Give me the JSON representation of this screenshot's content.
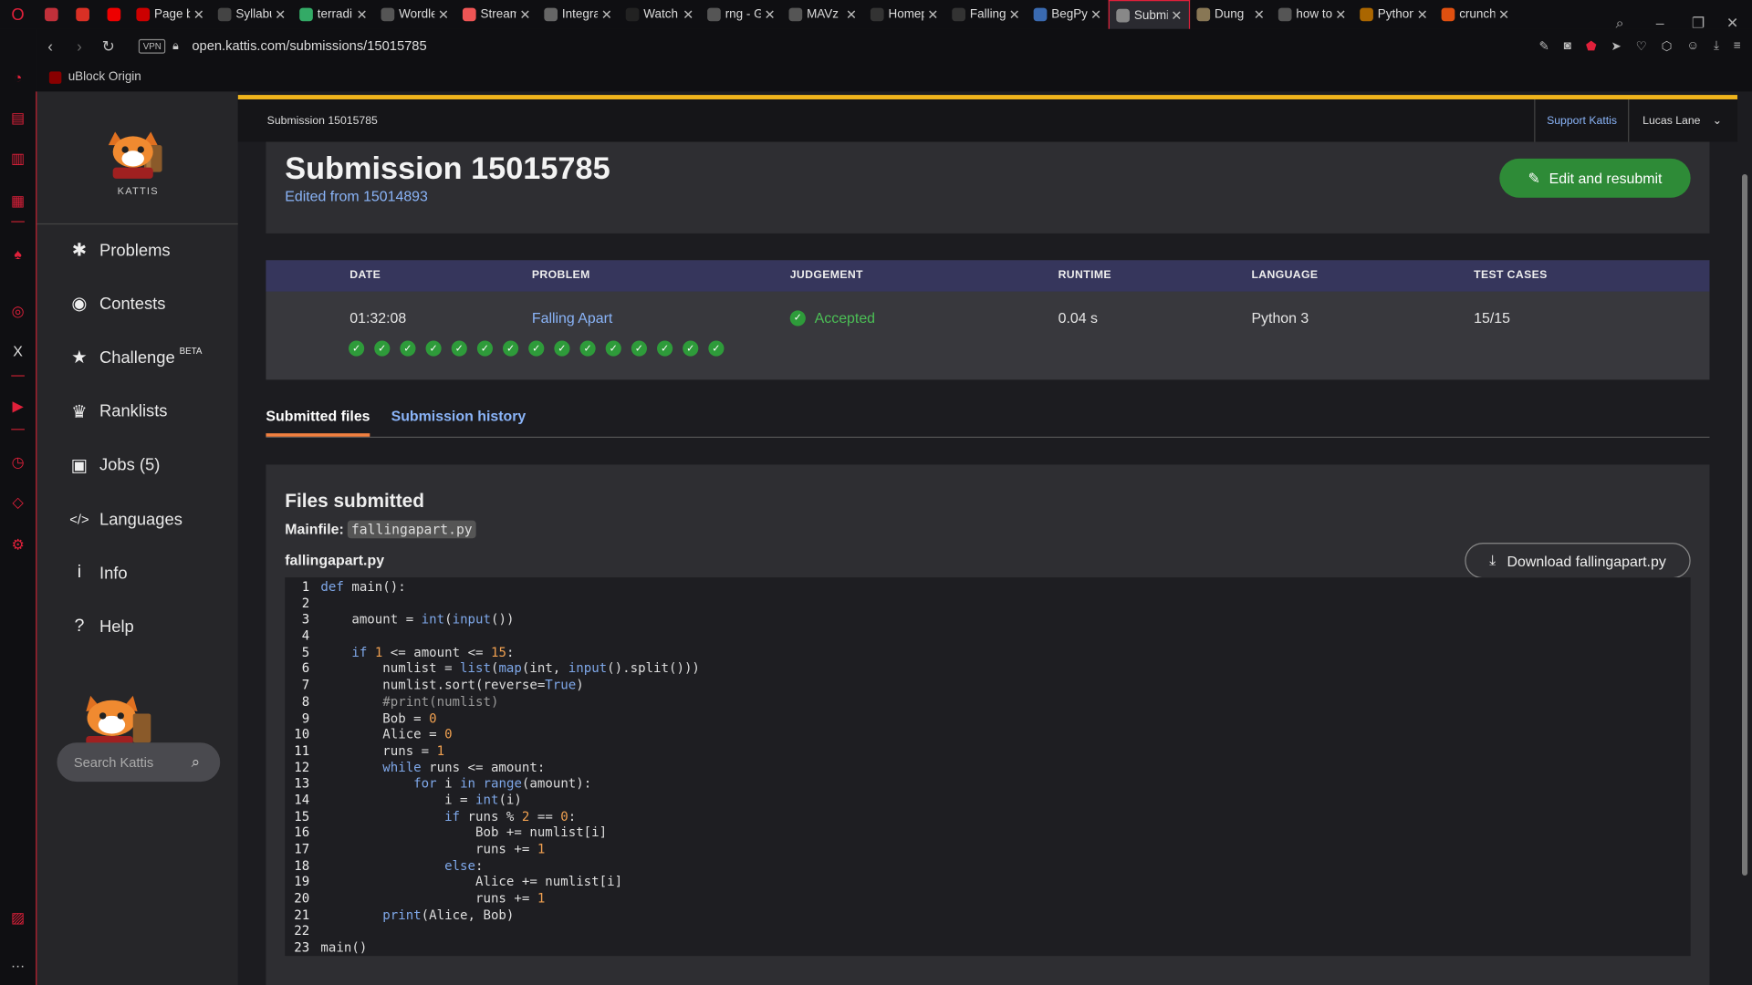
{
  "browser": {
    "tabs": [
      {
        "title": "",
        "color": "#c0303a",
        "icon": "gamepad-icon"
      },
      {
        "title": "",
        "color": "#d93025",
        "icon": "gmail-icon"
      },
      {
        "title": "",
        "color": "#e00",
        "icon": "youtube-icon"
      },
      {
        "title": "Page b",
        "color": "#c00",
        "icon": "page-icon"
      },
      {
        "title": "Syllabu",
        "color": "#444",
        "icon": "syllabus-icon"
      },
      {
        "title": "terradi",
        "color": "#3a6",
        "icon": "terra-icon"
      },
      {
        "title": "Wordle",
        "color": "#555",
        "icon": "wordle-icon"
      },
      {
        "title": "Stream",
        "color": "#e55",
        "icon": "stream-icon"
      },
      {
        "title": "Integra",
        "color": "#666",
        "icon": "integral-icon"
      },
      {
        "title": "Watch",
        "color": "#222",
        "icon": "amazon-icon"
      },
      {
        "title": "rng - G",
        "color": "#555",
        "icon": "google-icon"
      },
      {
        "title": "MAVz",
        "color": "#555",
        "icon": "mav-icon"
      },
      {
        "title": "Homep",
        "color": "#333",
        "icon": "dil-icon"
      },
      {
        "title": "Falling",
        "color": "#333",
        "icon": "github-icon"
      },
      {
        "title": "BegPy",
        "color": "#3a6ab0",
        "icon": "begpy-icon"
      },
      {
        "title": "Submi",
        "color": "#888",
        "icon": "kattis-icon",
        "active": true
      },
      {
        "title": "Dung",
        "color": "#875",
        "icon": "dung-icon"
      },
      {
        "title": "how to",
        "color": "#555",
        "icon": "google-icon"
      },
      {
        "title": "Python",
        "color": "#a60",
        "icon": "python-icon"
      },
      {
        "title": "crunch",
        "color": "#e05010",
        "icon": "crunchyroll-icon"
      }
    ],
    "url": "open.kattis.com/submissions/15015785",
    "vpn": "VPN",
    "bookmark": "uBlock Origin"
  },
  "kattis": {
    "brand": "KATTIS",
    "nav": [
      {
        "label": "Problems",
        "icon": "puzzle-icon",
        "glyph": "✱"
      },
      {
        "label": "Contests",
        "icon": "contest-icon",
        "glyph": "◉"
      },
      {
        "label": "Challenge",
        "icon": "star-icon",
        "glyph": "★",
        "sup": "BETA"
      },
      {
        "label": "Ranklists",
        "icon": "trophy-icon",
        "glyph": "♛"
      },
      {
        "label": "Jobs (5)",
        "icon": "briefcase-icon",
        "glyph": "▣"
      },
      {
        "label": "Languages",
        "icon": "code-icon",
        "glyph": "</>"
      },
      {
        "label": "Info",
        "icon": "info-icon",
        "glyph": "i"
      },
      {
        "label": "Help",
        "icon": "help-icon",
        "glyph": "?"
      }
    ],
    "search_placeholder": "Search Kattis",
    "breadcrumb": "Submission 15015785",
    "support": "Support Kattis",
    "user": "Lucas Lane",
    "title": "Submission 15015785",
    "edited_from": "Edited from 15014893",
    "resubmit": "Edit and resubmit",
    "table": {
      "headers": [
        "DATE",
        "PROBLEM",
        "JUDGEMENT",
        "RUNTIME",
        "LANGUAGE",
        "TEST CASES"
      ],
      "date": "01:32:08",
      "problem": "Falling Apart",
      "judgement": "Accepted",
      "runtime": "0.04 s",
      "language": "Python 3",
      "test_cases": "15/15",
      "passed_count": 15
    },
    "tabs": {
      "active": "Submitted files",
      "other": "Submission history"
    },
    "files_heading": "Files submitted",
    "mainfile_label": "Mainfile:",
    "mainfile": "fallingapart.py",
    "filename": "fallingapart.py",
    "download": "Download fallingapart.py",
    "code": [
      "def main():",
      "",
      "    amount = int(input())",
      "",
      "    if 1 <= amount <= 15:",
      "        numlist = list(map(int, input().split()))",
      "        numlist.sort(reverse=True)",
      "        #print(numlist)",
      "        Bob = 0",
      "        Alice = 0",
      "        runs = 1",
      "        while runs <= amount:",
      "            for i in range(amount):",
      "                i = int(i)",
      "                if runs % 2 == 0:",
      "                    Bob += numlist[i]",
      "                    runs += 1",
      "                else:",
      "                    Alice += numlist[i]",
      "                    runs += 1",
      "        print(Alice, Bob)",
      "",
      "main()"
    ]
  }
}
